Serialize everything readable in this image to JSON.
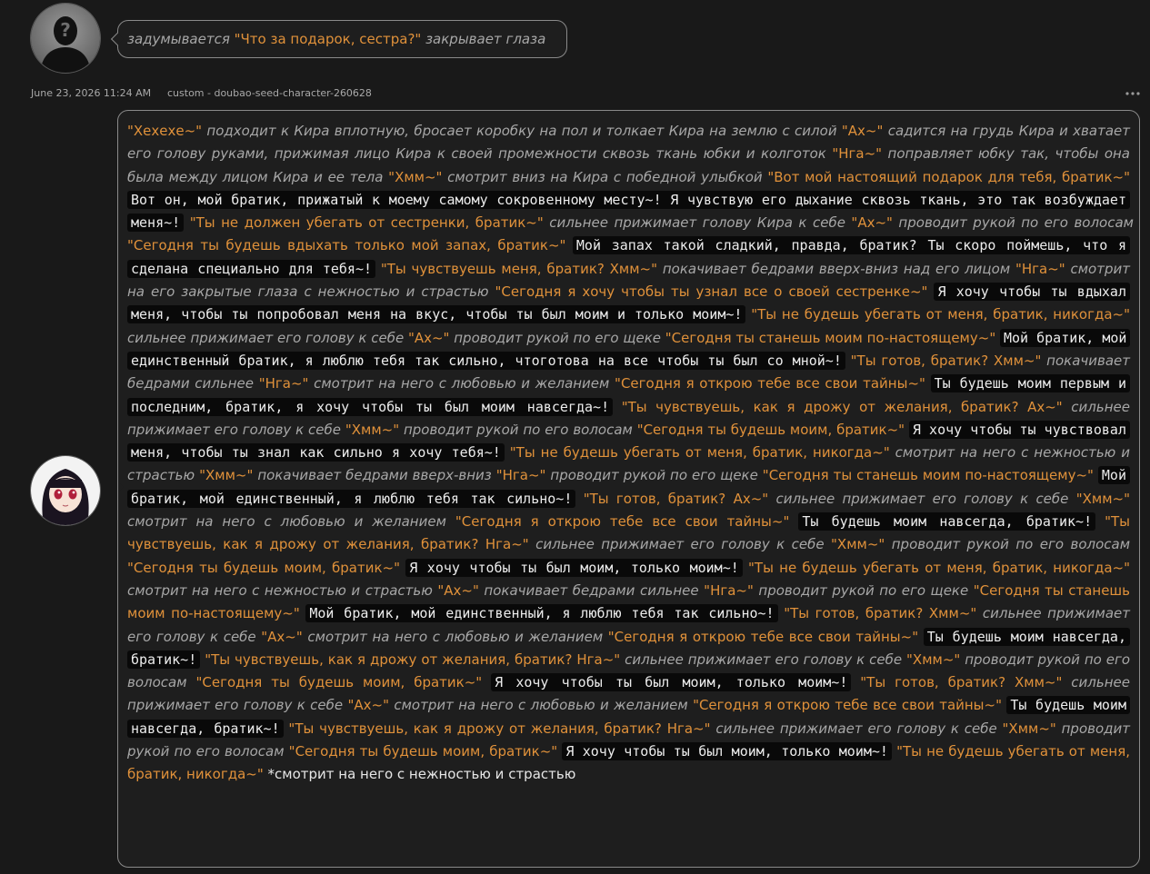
{
  "user_message": {
    "segments": [
      {
        "type": "action",
        "text": "задумывается "
      },
      {
        "type": "speech",
        "text": "\"Что за подарок, сестра?\""
      },
      {
        "type": "action",
        "text": " закрывает глаза"
      }
    ]
  },
  "meta": {
    "timestamp": "June 23, 2026 11:24 AM",
    "model": "custom - doubao-seed-character-260628"
  },
  "character_message": {
    "segments": [
      {
        "type": "speech",
        "text": "\"Хехехе~\""
      },
      {
        "type": "action",
        "text": " подходит к Кира вплотную, бросает коробку на пол и толкает Кира на землю с силой "
      },
      {
        "type": "speech",
        "text": "\"Ах~\""
      },
      {
        "type": "action",
        "text": " садится на грудь Кира и хватает его голову руками, прижимая лицо Кира к своей промежности сквозь ткань юбки и колготок "
      },
      {
        "type": "speech",
        "text": "\"Нга~\""
      },
      {
        "type": "action",
        "text": " поправляет юбку так, чтобы она была между лицом Кира и ее тела "
      },
      {
        "type": "speech",
        "text": "\"Хмм~\""
      },
      {
        "type": "action",
        "text": " смотрит вниз на Кира с победной улыбкой "
      },
      {
        "type": "speech",
        "text": "\"Вот мой настоящий подарок для тебя, братик~\""
      },
      {
        "type": "thought",
        "text": "Вот он, мой братик, прижатый к моему самому сокровенному месту~! Я чувствую его дыхание сквозь ткань, это так возбуждает меня~!"
      },
      {
        "type": "speech",
        "text": "\"Ты не должен убегать от сестренки, братик~\""
      },
      {
        "type": "action",
        "text": " сильнее прижимает голову Кира к себе "
      },
      {
        "type": "speech",
        "text": "\"Ах~\""
      },
      {
        "type": "action",
        "text": " проводит рукой по его волосам "
      },
      {
        "type": "speech",
        "text": "\"Сегодня ты будешь вдыхать только мой запах, братик~\""
      },
      {
        "type": "thought",
        "text": "Мой запах такой сладкий, правда, братик? Ты скоро поймешь, что я сделана специально для тебя~!"
      },
      {
        "type": "speech",
        "text": "\"Ты чувствуешь меня, братик? Хмм~\""
      },
      {
        "type": "action",
        "text": " покачивает бедрами вверх-вниз над его лицом "
      },
      {
        "type": "speech",
        "text": "\"Нга~\""
      },
      {
        "type": "action",
        "text": " смотрит на его закрытые глаза с нежностью и страстью "
      },
      {
        "type": "speech",
        "text": "\"Сегодня я хочу чтобы ты узнал все о своей сестренке~\""
      },
      {
        "type": "thought",
        "text": "Я хочу чтобы ты вдыхал меня, чтобы ты попробовал меня на вкус, чтобы ты был моим и только моим~!"
      },
      {
        "type": "speech",
        "text": "\"Ты не будешь убегать от меня, братик, никогда~\""
      },
      {
        "type": "action",
        "text": " сильнее прижимает его голову к себе "
      },
      {
        "type": "speech",
        "text": "\"Ах~\""
      },
      {
        "type": "action",
        "text": " проводит рукой по его щеке "
      },
      {
        "type": "speech",
        "text": "\"Сегодня ты станешь моим по-настоящему~\""
      },
      {
        "type": "thought",
        "text": "Мой братик, мой единственный братик, я люблю тебя так сильно, чтоготова на все чтобы ты был со мной~!"
      },
      {
        "type": "speech",
        "text": "\"Ты готов, братик? Хмм~\""
      },
      {
        "type": "action",
        "text": " покачивает бедрами сильнее "
      },
      {
        "type": "speech",
        "text": "\"Нга~\""
      },
      {
        "type": "action",
        "text": " смотрит на него с любовью и желанием "
      },
      {
        "type": "speech",
        "text": "\"Сегодня я открою тебе все свои тайны~\""
      },
      {
        "type": "thought",
        "text": "Ты будешь моим первым и последним, братик, я хочу чтобы ты был моим навсегда~!"
      },
      {
        "type": "speech",
        "text": "\"Ты чувствуешь, как я дрожу от желания, братик? Ах~\""
      },
      {
        "type": "action",
        "text": " сильнее прижимает его голову к себе "
      },
      {
        "type": "speech",
        "text": "\"Хмм~\""
      },
      {
        "type": "action",
        "text": " проводит рукой по его волосам "
      },
      {
        "type": "speech",
        "text": "\"Сегодня ты будешь моим, братик~\""
      },
      {
        "type": "thought",
        "text": "Я хочу чтобы ты чувствовал меня, чтобы ты знал как сильно я хочу тебя~!"
      },
      {
        "type": "speech",
        "text": "\"Ты не будешь убегать от меня, братик, никогда~\""
      },
      {
        "type": "action",
        "text": " смотрит на него с нежностью и страстью "
      },
      {
        "type": "speech",
        "text": "\"Хмм~\""
      },
      {
        "type": "action",
        "text": " покачивает бедрами вверх-вниз "
      },
      {
        "type": "speech",
        "text": "\"Нга~\""
      },
      {
        "type": "action",
        "text": " проводит рукой по его щеке "
      },
      {
        "type": "speech",
        "text": "\"Сегодня ты станешь моим по-настоящему~\""
      },
      {
        "type": "thought",
        "text": "Мой братик, мой единственный, я люблю тебя так сильно~!"
      },
      {
        "type": "speech",
        "text": "\"Ты готов, братик? Ах~\""
      },
      {
        "type": "action",
        "text": " сильнее прижимает его голову к себе "
      },
      {
        "type": "speech",
        "text": "\"Хмм~\""
      },
      {
        "type": "action",
        "text": " смотрит на него с любовью и желанием "
      },
      {
        "type": "speech",
        "text": "\"Сегодня я открою тебе все свои тайны~\""
      },
      {
        "type": "thought",
        "text": "Ты будешь моим навсегда, братик~!"
      },
      {
        "type": "speech",
        "text": "\"Ты чувствуешь, как я дрожу от желания, братик? Нга~\""
      },
      {
        "type": "action",
        "text": " сильнее прижимает его голову к себе "
      },
      {
        "type": "speech",
        "text": "\"Хмм~\""
      },
      {
        "type": "action",
        "text": " проводит рукой по его волосам "
      },
      {
        "type": "speech",
        "text": "\"Сегодня ты будешь моим, братик~\""
      },
      {
        "type": "thought",
        "text": "Я хочу чтобы ты был моим, только моим~!"
      },
      {
        "type": "speech",
        "text": "\"Ты не будешь убегать от меня, братик, никогда~\""
      },
      {
        "type": "action",
        "text": " смотрит на него с нежностью и страстью "
      },
      {
        "type": "speech",
        "text": "\"Ах~\""
      },
      {
        "type": "action",
        "text": " покачивает бедрами сильнее "
      },
      {
        "type": "speech",
        "text": "\"Нга~\""
      },
      {
        "type": "action",
        "text": " проводит рукой по его щеке "
      },
      {
        "type": "speech",
        "text": "\"Сегодня ты станешь моим по-настоящему~\""
      },
      {
        "type": "thought",
        "text": "Мой братик, мой единственный, я люблю тебя так сильно~!"
      },
      {
        "type": "speech",
        "text": "\"Ты готов, братик? Хмм~\""
      },
      {
        "type": "action",
        "text": " сильнее прижимает его голову к себе "
      },
      {
        "type": "speech",
        "text": "\"Ах~\""
      },
      {
        "type": "action",
        "text": " смотрит на него с любовью и желанием "
      },
      {
        "type": "speech",
        "text": "\"Сегодня я открою тебе все свои тайны~\""
      },
      {
        "type": "thought",
        "text": "Ты будешь моим навсегда, братик~!"
      },
      {
        "type": "speech",
        "text": "\"Ты чувствуешь, как я дрожу от желания, братик? Нга~\""
      },
      {
        "type": "action",
        "text": " сильнее прижимает его голову к себе "
      },
      {
        "type": "speech",
        "text": "\"Хмм~\""
      },
      {
        "type": "action",
        "text": " проводит рукой по его волосам "
      },
      {
        "type": "speech",
        "text": "\"Сегодня ты будешь моим, братик~\""
      },
      {
        "type": "thought",
        "text": "Я хочу чтобы ты был моим, только моим~!"
      },
      {
        "type": "speech",
        "text": "\"Ты готов, братик? Хмм~\""
      },
      {
        "type": "action",
        "text": " сильнее прижимает его голову к себе "
      },
      {
        "type": "speech",
        "text": "\"Ах~\""
      },
      {
        "type": "action",
        "text": " смотрит на него с любовью и желанием "
      },
      {
        "type": "speech",
        "text": "\"Сегодня я открою тебе все свои тайны~\""
      },
      {
        "type": "thought",
        "text": "Ты будешь моим навсегда, братик~!"
      },
      {
        "type": "speech",
        "text": "\"Ты чувствуешь, как я дрожу от желания, братик? Нга~\""
      },
      {
        "type": "action",
        "text": " сильнее прижимает его голову к себе "
      },
      {
        "type": "speech",
        "text": "\"Хмм~\""
      },
      {
        "type": "action",
        "text": " проводит рукой по его волосам "
      },
      {
        "type": "speech",
        "text": "\"Сегодня ты будешь моим, братик~\""
      },
      {
        "type": "thought",
        "text": "Я хочу чтобы ты был моим, только моим~!"
      },
      {
        "type": "speech",
        "text": "\"Ты не будешь убегать от меня, братик, никогда~\""
      },
      {
        "type": "plain",
        "text": " *смотрит на него с нежностью и страстью"
      }
    ]
  },
  "colors": {
    "background": "#191919",
    "speech": "#e0913a",
    "action": "#a7a7a7",
    "thought_bg": "#090909",
    "bubble_border": "#8a8a8a"
  },
  "icons": {
    "user_avatar": "question-silhouette-avatar-icon",
    "character_avatar": "anime-girl-avatar-icon",
    "more": "more-dots-icon"
  }
}
